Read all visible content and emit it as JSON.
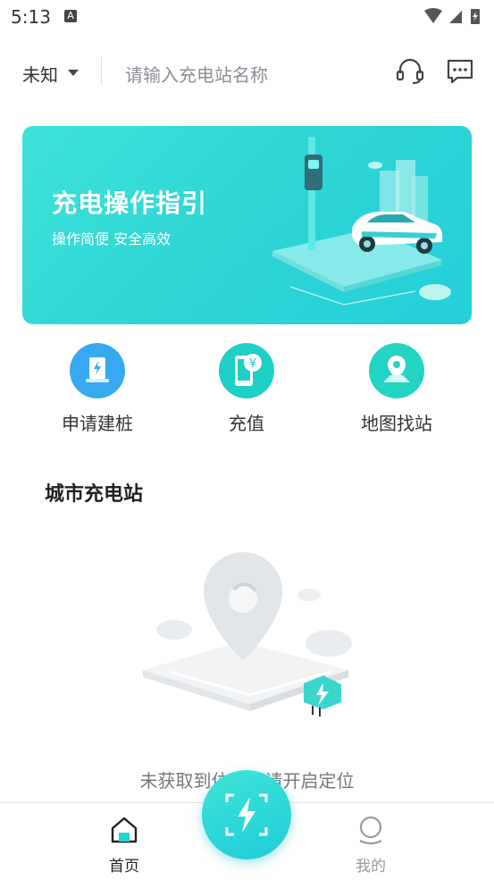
{
  "status_bar": {
    "time": "5:13",
    "notification_icon": "A"
  },
  "header": {
    "location_label": "未知",
    "search_placeholder": "请输入充电站名称",
    "icons": [
      "headset-icon",
      "message-icon"
    ]
  },
  "banner": {
    "title": "充电操作指引",
    "subtitle": "操作简便  安全高效"
  },
  "quick_actions": [
    {
      "label": "申请建桩",
      "icon": "charging-pile-icon"
    },
    {
      "label": "充值",
      "icon": "recharge-icon"
    },
    {
      "label": "地图找站",
      "icon": "map-pin-icon"
    }
  ],
  "section": {
    "title": "城市充电站",
    "empty_text": "未获取到位置，请开启定位"
  },
  "tabbar": {
    "home_label": "首页",
    "mine_label": "我的",
    "scan_icon": "scan-charge-icon"
  },
  "colors": {
    "accent": "#22d3d4",
    "tab_active": "#222222",
    "tab_inactive": "#9a9a9a"
  }
}
